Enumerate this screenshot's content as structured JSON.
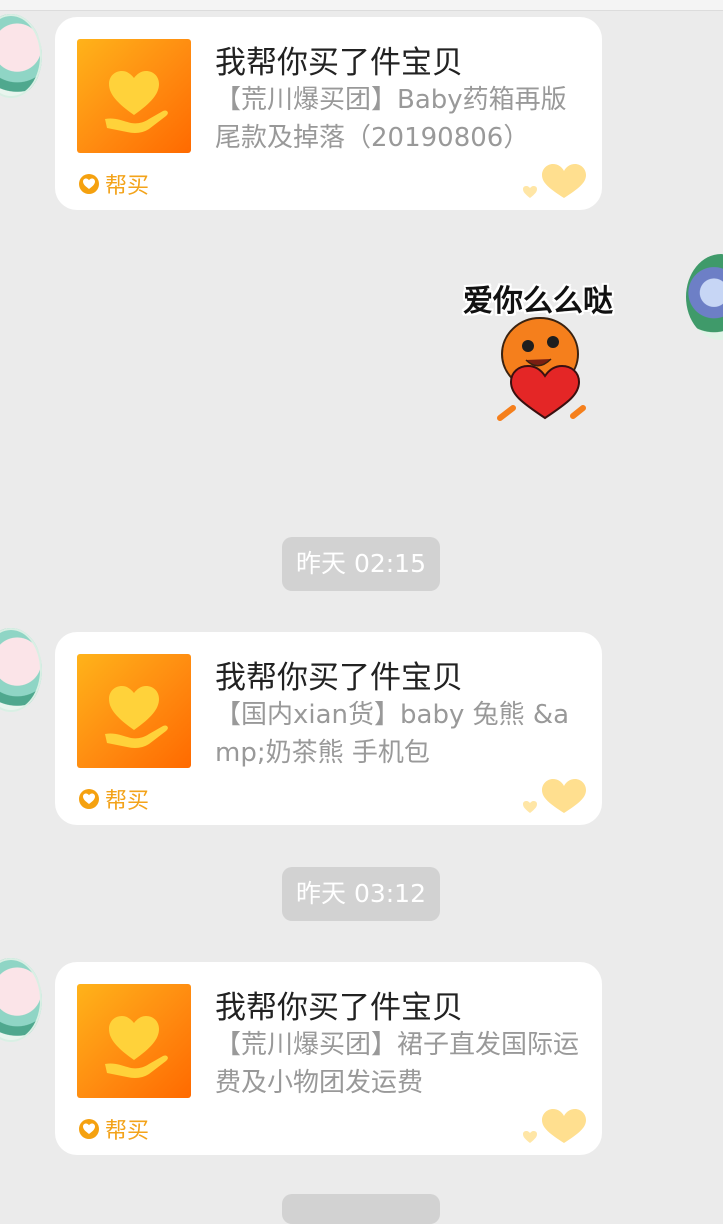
{
  "messages": [
    {
      "title": "我帮你买了件宝贝",
      "desc": "【荒川爆买团】Baby药箱再版尾款及掉落（20190806）",
      "tag": "帮买"
    },
    {
      "title": "我帮你买了件宝贝",
      "desc": "【国内xian货】baby 兔熊 &amp;奶茶熊 手机包",
      "tag": "帮买"
    },
    {
      "title": "我帮你买了件宝贝",
      "desc": "【荒川爆买团】裙子直发国际运费及小物团发运费",
      "tag": "帮买"
    }
  ],
  "sticker": {
    "text": "爱你么么哒"
  },
  "timestamps": [
    "昨天  02:15",
    "昨天  03:12"
  ],
  "colors": {
    "accent": "#ff8a10",
    "tag": "#f3a31a",
    "background": "#ebebeb"
  }
}
